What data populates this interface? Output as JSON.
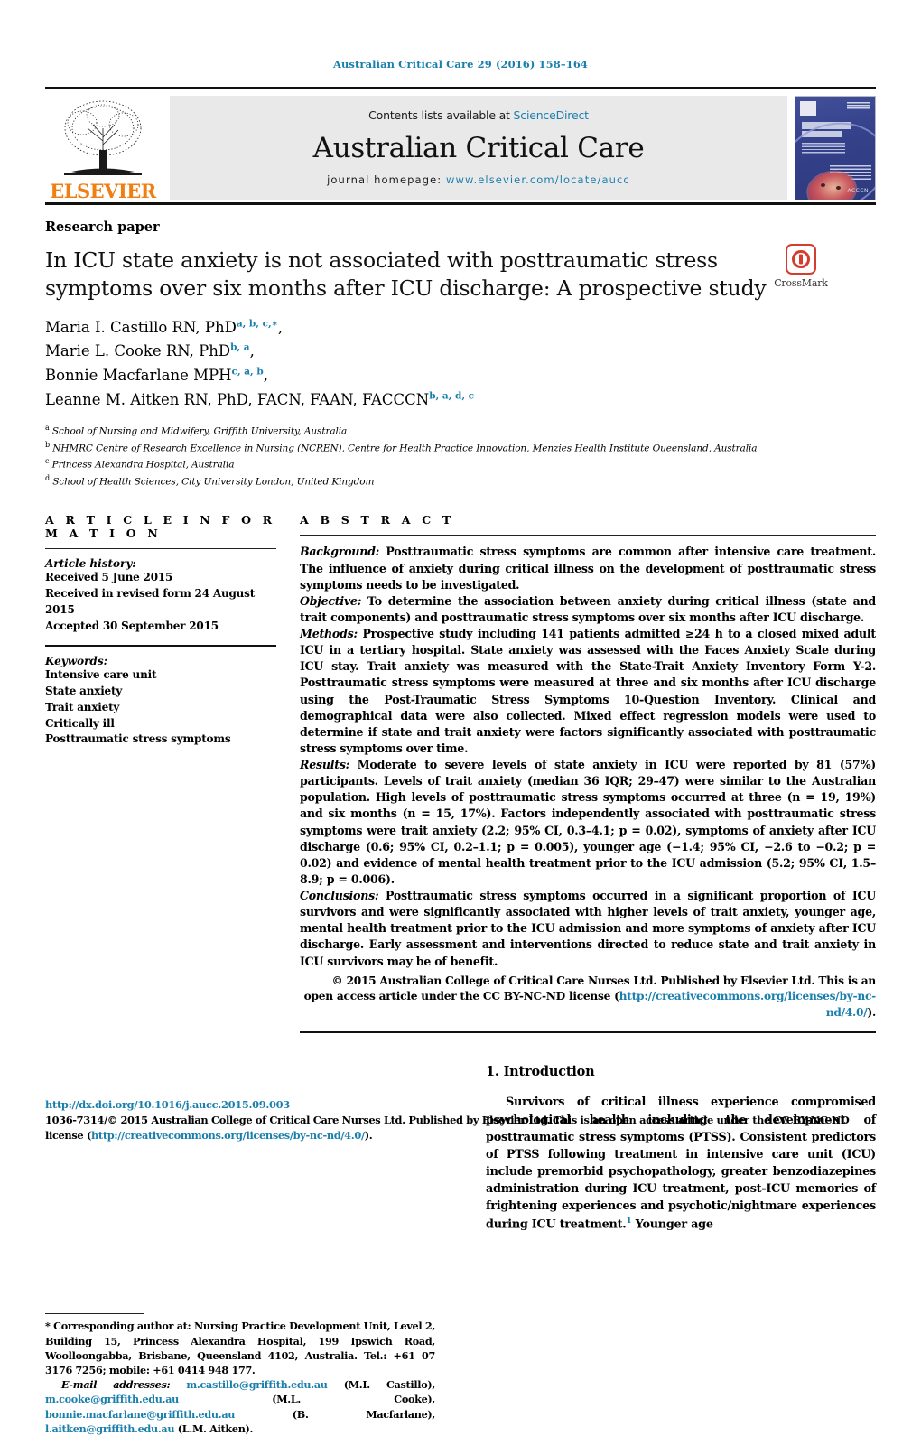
{
  "running_head": "Australian Critical Care 29 (2016) 158–164",
  "masthead": {
    "contents_prefix": "Contents lists available at ",
    "sciencedirect": "ScienceDirect",
    "journal_name": "Australian Critical Care",
    "homepage_prefix": "journal homepage: ",
    "homepage_url": "www.elsevier.com/locate/aucc",
    "publisher": "ELSEVIER",
    "cover_brand": "ACCCN"
  },
  "article": {
    "type": "Research paper",
    "title": "In ICU state anxiety is not associated with posttraumatic stress symptoms over six months after ICU discharge: A prospective study",
    "crossmark_label": "CrossMark",
    "authors": [
      {
        "name": "Maria I. Castillo RN, PhD",
        "sup": "a, b, c,∗",
        "tail": ","
      },
      {
        "name": "Marie L. Cooke RN, PhD",
        "sup": "b, a",
        "tail": ","
      },
      {
        "name": "Bonnie Macfarlane MPH",
        "sup": "c, a, b",
        "tail": ","
      },
      {
        "name": "Leanne M. Aitken RN, PhD, FACN, FAAN, FACCCN",
        "sup": "b, a, d, c",
        "tail": ""
      }
    ],
    "affiliations": [
      {
        "mark": "a",
        "text": "School of Nursing and Midwifery, Griffith University, Australia"
      },
      {
        "mark": "b",
        "text": "NHMRC Centre of Research Excellence in Nursing (NCREN), Centre for Health Practice Innovation, Menzies Health Institute Queensland, Australia"
      },
      {
        "mark": "c",
        "text": "Princess Alexandra Hospital, Australia"
      },
      {
        "mark": "d",
        "text": "School of Health Sciences, City University London, United Kingdom"
      }
    ]
  },
  "article_information": {
    "heading": "A R T I C L E  I N F O R M A T I O N",
    "history_label": "Article history:",
    "history": [
      "Received 5 June 2015",
      "Received in revised form 24 August 2015",
      "Accepted 30 September 2015"
    ],
    "keywords_label": "Keywords:",
    "keywords": [
      "Intensive care unit",
      "State anxiety",
      "Trait anxiety",
      "Critically ill",
      "Posttraumatic stress symptoms"
    ]
  },
  "abstract": {
    "heading": "A B S T R A C T",
    "sections": [
      {
        "label": "Background:",
        "text": " Posttraumatic stress symptoms are common after intensive care treatment. The influence of anxiety during critical illness on the development of posttraumatic stress symptoms needs to be investigated."
      },
      {
        "label": "Objective:",
        "text": " To determine the association between anxiety during critical illness (state and trait components) and posttraumatic stress symptoms over six months after ICU discharge."
      },
      {
        "label": "Methods:",
        "text": " Prospective study including 141 patients admitted ≥24 h to a closed mixed adult ICU in a tertiary hospital. State anxiety was assessed with the Faces Anxiety Scale during ICU stay. Trait anxiety was measured with the State-Trait Anxiety Inventory Form Y-2. Posttraumatic stress symptoms were measured at three and six months after ICU discharge using the Post-Traumatic Stress Symptoms 10-Question Inventory. Clinical and demographical data were also collected. Mixed effect regression models were used to determine if state and trait anxiety were factors significantly associated with posttraumatic stress symptoms over time."
      },
      {
        "label": "Results:",
        "text": " Moderate to severe levels of state anxiety in ICU were reported by 81 (57%) participants. Levels of trait anxiety (median 36 IQR; 29–47) were similar to the Australian population. High levels of posttraumatic stress symptoms occurred at three (n = 19, 19%) and six months (n = 15, 17%). Factors independently associated with posttraumatic stress symptoms were trait anxiety (2.2; 95% CI, 0.3–4.1; p = 0.02), symptoms of anxiety after ICU discharge (0.6; 95% CI, 0.2–1.1; p = 0.005), younger age (−1.4; 95% CI, −2.6 to −0.2; p = 0.02) and evidence of mental health treatment prior to the ICU admission (5.2; 95% CI, 1.5–8.9; p = 0.006)."
      },
      {
        "label": "Conclusions:",
        "text": " Posttraumatic stress symptoms occurred in a significant proportion of ICU survivors and were significantly associated with higher levels of trait anxiety, younger age, mental health treatment prior to the ICU admission and more symptoms of anxiety after ICU discharge. Early assessment and interventions directed to reduce state and trait anxiety in ICU survivors may be of benefit."
      }
    ],
    "copyright_text": "© 2015 Australian College of Critical Care Nurses Ltd. Published by Elsevier Ltd. This is an open access article under the CC BY-NC-ND license (",
    "copyright_link": "http://creativecommons.org/licenses/by-nc-nd/4.0/",
    "copyright_tail": ")."
  },
  "footnote": {
    "corresponding": "* Corresponding author at: Nursing Practice Development Unit, Level 2, Building 15, Princess Alexandra Hospital, 199 Ipswich Road, Woolloongabba, Brisbane, Queensland 4102, Australia. Tel.: +61 07 3176 7256; mobile: +61 0414 948 177.",
    "email_label": "E-mail addresses:",
    "emails": [
      {
        "addr": "m.castillo@griffith.edu.au",
        "owner": " (M.I. Castillo),"
      },
      {
        "addr": "m.cooke@griffith.edu.au",
        "owner": " (M.L. Cooke),"
      },
      {
        "addr": "bonnie.macfarlane@griffith.edu.au",
        "owner": " (B. Macfarlane),"
      },
      {
        "addr": "l.aitken@griffith.edu.au",
        "owner": " (L.M. Aitken)."
      }
    ]
  },
  "introduction": {
    "heading": "1. Introduction",
    "paragraph_a": "Survivors of critical illness experience compromised psychological health including the development of posttraumatic stress symptoms (PTSS). Consistent predictors of PTSS following treatment in intensive care unit (ICU) include premorbid psychopathology, greater benzodiazepines administration during ICU treatment, post-ICU memories of frightening experiences and psychotic/nightmare experiences during ICU treatment.",
    "ref_marker": "1",
    "paragraph_b": " Younger age"
  },
  "bottom": {
    "doi": "http://dx.doi.org/10.1016/j.aucc.2015.09.003",
    "issn_prefix": "1036-7314/© 2015 Australian College of Critical Care Nurses Ltd. Published by Elsevier Ltd. This is an open access article under the CC BY-NC-ND license (",
    "issn_link": "http://creativecommons.org/licenses/by-nc-nd/4.0/",
    "issn_tail": ")."
  },
  "colors": {
    "link": "#1a7fad",
    "elsevier_orange": "#f07f13",
    "crossmark_red": "#d43c2d"
  }
}
